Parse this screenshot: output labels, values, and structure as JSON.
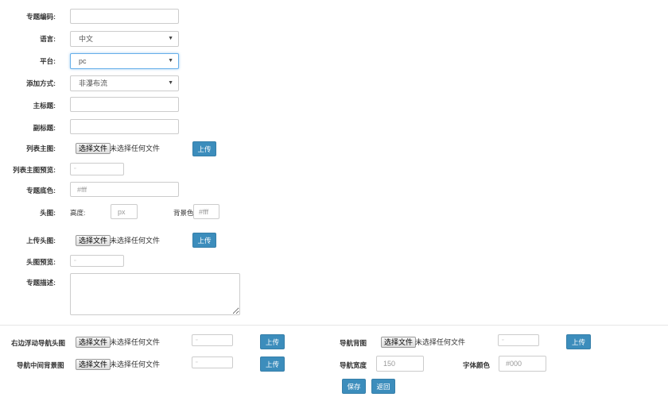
{
  "form": {
    "topic_code": {
      "label": "专题编码:",
      "value": ""
    },
    "language": {
      "label": "语言:",
      "value": "中文"
    },
    "platform": {
      "label": "平台:",
      "value": "pc"
    },
    "add_mode": {
      "label": "添加方式:",
      "value": "非瀑布流"
    },
    "main_title": {
      "label": "主标题:",
      "value": ""
    },
    "sub_title": {
      "label": "副标题:",
      "value": ""
    },
    "list_image": {
      "label": "列表主图:",
      "choose_label": "选择文件",
      "no_file_text": "未选择任何文件",
      "upload_label": "上传"
    },
    "list_image_preview": {
      "label": "列表主图预览:",
      "value": ""
    },
    "bg_color": {
      "label": "专题底色:",
      "placeholder": "#fff"
    },
    "head_image": {
      "label": "头图:",
      "height_label": "高度:",
      "height_placeholder": "px",
      "bgcolor_label": "背景色:",
      "bgcolor_placeholder": "#fff"
    },
    "upload_head_image": {
      "label": "上传头图:",
      "choose_label": "选择文件",
      "no_file_text": "未选择任何文件",
      "upload_label": "上传"
    },
    "head_image_preview": {
      "label": "头图预览:",
      "value": ""
    },
    "description": {
      "label": "专题描述:",
      "value": ""
    },
    "right_float_nav_image": {
      "label": "右边浮动导航头图",
      "choose_label": "选择文件",
      "no_file_text": "未选择任何文件",
      "upload_label": "上传"
    },
    "nav_bar_image": {
      "label": "导航背图",
      "choose_label": "选择文件",
      "no_file_text": "未选择任何文件",
      "upload_label": "上传"
    },
    "nav_middle_bg_image": {
      "label": "导航中间背景图",
      "choose_label": "选择文件",
      "no_file_text": "未选择任何文件",
      "upload_label": "上传"
    },
    "nav_width": {
      "label": "导航宽度",
      "placeholder": "150"
    },
    "font_color": {
      "label": "字体颜色",
      "placeholder": "#000"
    }
  },
  "actions": {
    "save_label": "保存",
    "back_label": "返回"
  },
  "colors": {
    "primary": "#3c8dbc",
    "focus": "#66afe9"
  }
}
